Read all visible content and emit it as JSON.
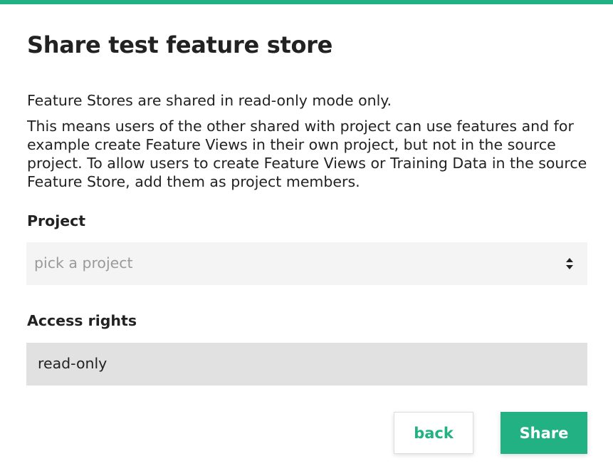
{
  "dialog": {
    "title": "Share test feature store",
    "description_line1": "Feature Stores are shared in read-only mode only.",
    "description_line2": "This means users of the other shared with project can use features and for example create Feature Views in their own project, but not in the source project. To allow users to create Feature Views or Training Data in the source Feature Store, add them as project members."
  },
  "project_field": {
    "label": "Project",
    "placeholder": "pick a project",
    "icon": "sort-arrows-icon"
  },
  "access_field": {
    "label": "Access rights",
    "value": "read-only"
  },
  "buttons": {
    "back_label": "back",
    "share_label": "Share"
  },
  "colors": {
    "accent": "#21b182",
    "select_bg": "#f4f4f4",
    "readonly_bg": "#e1e1e1",
    "text": "#222222",
    "placeholder": "#9a9a9a"
  }
}
